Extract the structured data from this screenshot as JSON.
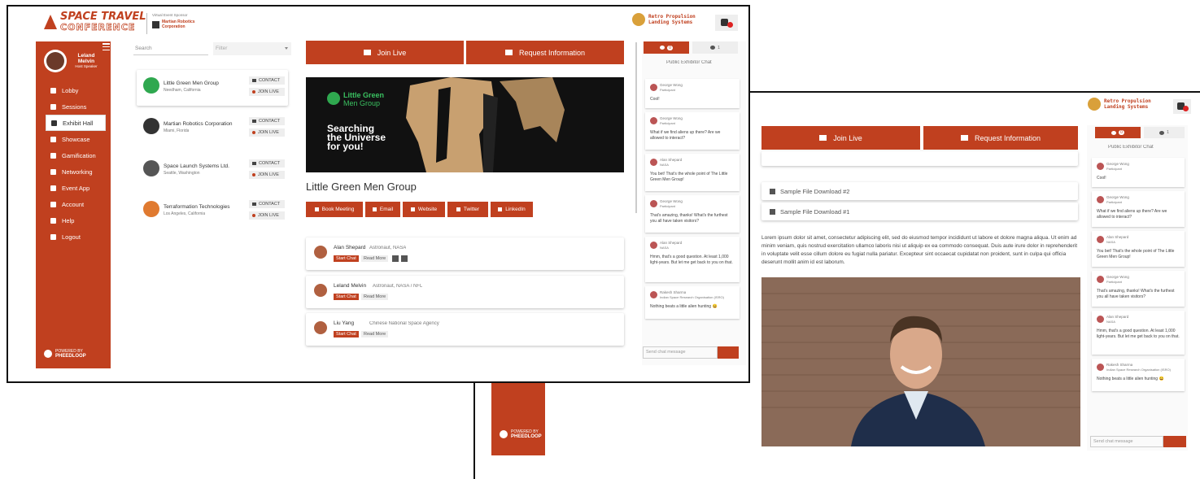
{
  "header": {
    "conference_title_line1": "SPACE TRAVEL",
    "conference_title_line2": "CONFERENCE",
    "sponsor_caption": "Virtual Event Sponsor",
    "sponsor_name_line1": "Martian Robotics",
    "sponsor_name_line2": "Corporation",
    "right_sponsor_line1": "Retro Propulsion",
    "right_sponsor_line2": "Landing Systems"
  },
  "sidebar": {
    "user_first": "Leland",
    "user_last": "Melvin",
    "user_role": "Host Speaker",
    "items": [
      {
        "label": "Lobby",
        "icon": "home-icon"
      },
      {
        "label": "Sessions",
        "icon": "calendar-icon"
      },
      {
        "label": "Exhibit Hall",
        "icon": "grid-icon"
      },
      {
        "label": "Showcase",
        "icon": "trophy-icon"
      },
      {
        "label": "Gamification",
        "icon": "trophy-icon"
      },
      {
        "label": "Networking",
        "icon": "network-icon"
      },
      {
        "label": "Event App",
        "icon": "phone-icon"
      },
      {
        "label": "Account",
        "icon": "gear-icon"
      },
      {
        "label": "Help",
        "icon": "help-icon"
      },
      {
        "label": "Logout",
        "icon": "logout-icon"
      }
    ],
    "powered_by": "POWERED BY",
    "powered_brand": "PHEEDLOOP"
  },
  "exhibitors": {
    "search_placeholder": "Search",
    "filter_placeholder": "Filter",
    "contact_label": "CONTACT",
    "join_live_label": "JOIN LIVE",
    "items": [
      {
        "name": "Little Green Men Group",
        "location": "Needham, California"
      },
      {
        "name": "Martian Robotics Corporation",
        "location": "Miami, Florida"
      },
      {
        "name": "Space Launch Systems Ltd.",
        "location": "Seattle, Washington"
      },
      {
        "name": "Terraformation Technologies",
        "location": "Los Angeles, California"
      }
    ]
  },
  "main": {
    "join_live": "Join Live",
    "request_info": "Request Information",
    "banner_company_line1": "Little Green",
    "banner_company_line2": "Men Group",
    "banner_tagline_line1": "Searching",
    "banner_tagline_line2": "the Universe",
    "banner_tagline_line3": "for you!",
    "company_title": "Little Green Men Group",
    "actions": [
      "Book Meeting",
      "Email",
      "Website",
      "Twitter",
      "LinkedIn"
    ],
    "start_chat": "Start Chat",
    "read_more": "Read More",
    "staff": [
      {
        "name": "Alan Shepard",
        "role": "Astronaut, NASA"
      },
      {
        "name": "Leland Melvin",
        "role": "Astronaut, NASA / NFL"
      },
      {
        "name": "Liu Yang",
        "role": "Chinese National Space Agency"
      }
    ]
  },
  "chat": {
    "tab_chat_count": "0",
    "tab_people_count": "1",
    "public_label": "Public Exhibitor Chat",
    "send_placeholder": "Send chat message",
    "messages": [
      {
        "name": "George Wong",
        "role": "Participant",
        "text": "Cool!"
      },
      {
        "name": "George Wong",
        "role": "Participant",
        "text": "What if we find aliens up there? Are we allowed to interact?"
      },
      {
        "name": "Alan Shepard",
        "role": "NASA",
        "text": "You bet! That's the whole point of The Little Green Men Group!"
      },
      {
        "name": "George Wong",
        "role": "Participant",
        "text": "That's amazing, thanks! What's the furthest you all have taken visitors?"
      },
      {
        "name": "Alan Shepard",
        "role": "NASA",
        "text": "Hmm, that's a good question. At least 1,000 light-years. But let me get back to you on that."
      },
      {
        "name": "Rakesh Sharma",
        "role": "Indian Space Research Organisation (ISRO)",
        "text": "Nothing beats a little alien hunting 😀"
      }
    ]
  },
  "second": {
    "downloads": [
      "Sample File Download #2",
      "Sample File Download #1"
    ],
    "lorem": "Lorem ipsum dolor sit amet, consectetur adipiscing elit, sed do eiusmod tempor incididunt ut labore et dolore magna aliqua. Ut enim ad minim veniam, quis nostrud exercitation ullamco laboris nisi ut aliquip ex ea commodo consequat. Duis aute irure dolor in reprehenderit in voluptate velit esse cillum dolore eu fugiat nulla pariatur. Excepteur sint occaecat cupidatat non proident, sunt in culpa qui officia deserunt mollit anim id est laborum."
  },
  "colors": {
    "accent": "#c0401f",
    "banner_bg": "#111111",
    "banner_panel": "#c8a070"
  }
}
